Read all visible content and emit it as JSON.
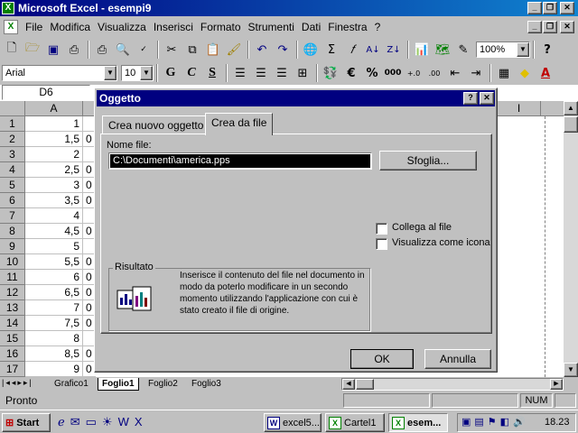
{
  "app": {
    "title": "Microsoft Excel - esempi9"
  },
  "menu": [
    "File",
    "Modifica",
    "Visualizza",
    "Inserisci",
    "Formato",
    "Strumenti",
    "Dati",
    "Finestra",
    "?"
  ],
  "toolbar": {
    "zoom": "100%"
  },
  "format_toolbar": {
    "font": "Arial",
    "size": "10",
    "bold": "G",
    "italic": "C",
    "underline": "S",
    "thousands": "000"
  },
  "name_box": "D6",
  "grid": {
    "col_a": "A",
    "col_i": "I",
    "rows": [
      {
        "n": "1",
        "a": "1",
        "b": ""
      },
      {
        "n": "2",
        "a": "1,5",
        "b": "0"
      },
      {
        "n": "3",
        "a": "2",
        "b": ""
      },
      {
        "n": "4",
        "a": "2,5",
        "b": "0"
      },
      {
        "n": "5",
        "a": "3",
        "b": "0"
      },
      {
        "n": "6",
        "a": "3,5",
        "b": "0"
      },
      {
        "n": "7",
        "a": "4",
        "b": ""
      },
      {
        "n": "8",
        "a": "4,5",
        "b": "0"
      },
      {
        "n": "9",
        "a": "5",
        "b": ""
      },
      {
        "n": "10",
        "a": "5,5",
        "b": "0"
      },
      {
        "n": "11",
        "a": "6",
        "b": "0"
      },
      {
        "n": "12",
        "a": "6,5",
        "b": "0"
      },
      {
        "n": "13",
        "a": "7",
        "b": "0"
      },
      {
        "n": "14",
        "a": "7,5",
        "b": "0"
      },
      {
        "n": "15",
        "a": "8",
        "b": ""
      },
      {
        "n": "16",
        "a": "8,5",
        "b": "0"
      },
      {
        "n": "17",
        "a": "9",
        "b": "0"
      }
    ]
  },
  "sheets": [
    "Grafico1",
    "Foglio1",
    "Foglio2",
    "Foglio3"
  ],
  "status": {
    "left": "Pronto",
    "num": "NUM"
  },
  "dialog": {
    "title": "Oggetto",
    "help": "?",
    "close": "✕",
    "tabs": [
      "Crea nuovo oggetto",
      "Crea da file"
    ],
    "file_label": "Nome file:",
    "file_value": "C:\\Documenti\\america.pps",
    "browse": "Sfoglia...",
    "link_label": "Collega al file",
    "icon_label": "Visualizza come icona",
    "result_title": "Risultato",
    "result_text": "Inserisce il contenuto del file nel documento in modo da poterlo modificare in un secondo momento utilizzando l'applicazione con cui è stato creato il file di origine.",
    "ok": "OK",
    "cancel": "Annulla"
  },
  "taskbar": {
    "start": "Start",
    "tasks": [
      "excel5...",
      "Cartel1",
      "esem..."
    ],
    "clock": "18.23"
  }
}
